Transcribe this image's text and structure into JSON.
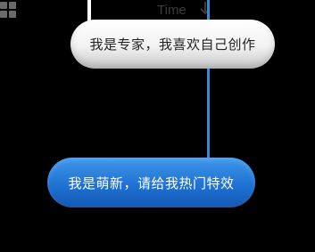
{
  "header": {
    "title": "Time",
    "menu_icon": "grid-icon",
    "sort_icon": "sort-down-arrow-icon"
  },
  "messages": [
    {
      "role": "expert",
      "text": "我是专家，我喜欢自己创作"
    },
    {
      "role": "newbie",
      "text": "我是萌新，请给我热门特效"
    }
  ],
  "colors": {
    "background": "#000000",
    "blue_bubble": "#2a7fe0",
    "blue_line": "#3b88d8",
    "white_bubble": "#f2f2f2"
  }
}
